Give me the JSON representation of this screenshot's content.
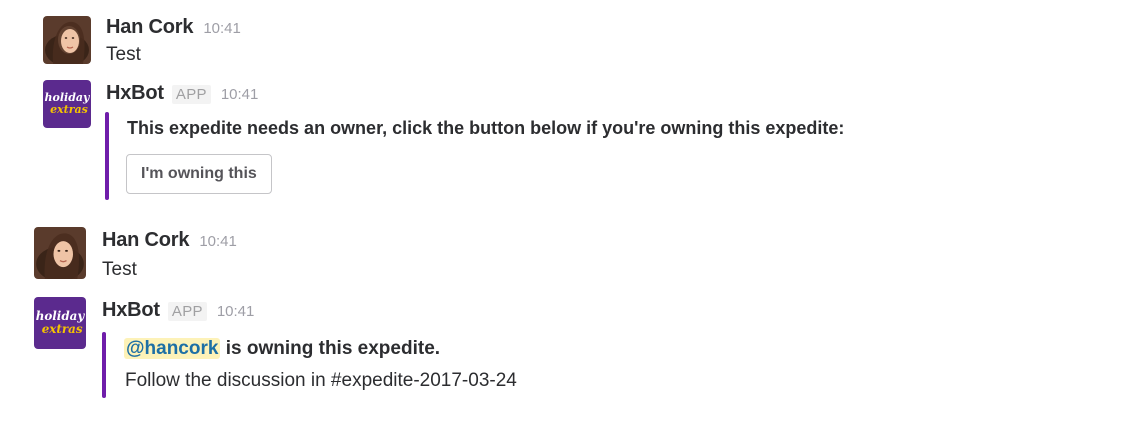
{
  "messages": [
    {
      "author": "Han Cork",
      "time": "10:41",
      "text": "Test"
    },
    {
      "author": "HxBot",
      "badge": "APP",
      "time": "10:41",
      "attachment_text": "This expedite needs an owner, click the button below if you're owning this expedite:",
      "button_label": "I'm owning this"
    },
    {
      "author": "Han Cork",
      "time": "10:41",
      "text": "Test"
    },
    {
      "author": "HxBot",
      "badge": "APP",
      "time": "10:41",
      "mention": "@hancork",
      "owning_text": " is owning this expedite.",
      "discussion_text": "Follow the discussion in #expedite-2017-03-24"
    }
  ],
  "bot_logo": {
    "line1": "holiday",
    "line2": "extras"
  },
  "colors": {
    "attachment_bar": "#6f1daa",
    "bot_avatar_bg": "#5b2a8e",
    "bot_logo_line1": "#ffffff",
    "bot_logo_line2": "#f5c400",
    "mention_text": "#1d6fa5",
    "mention_bg": "#fdf2b8"
  },
  "icons": {
    "user_avatar": "user-avatar-photo",
    "bot_avatar": "holiday-extras-logo-icon"
  }
}
